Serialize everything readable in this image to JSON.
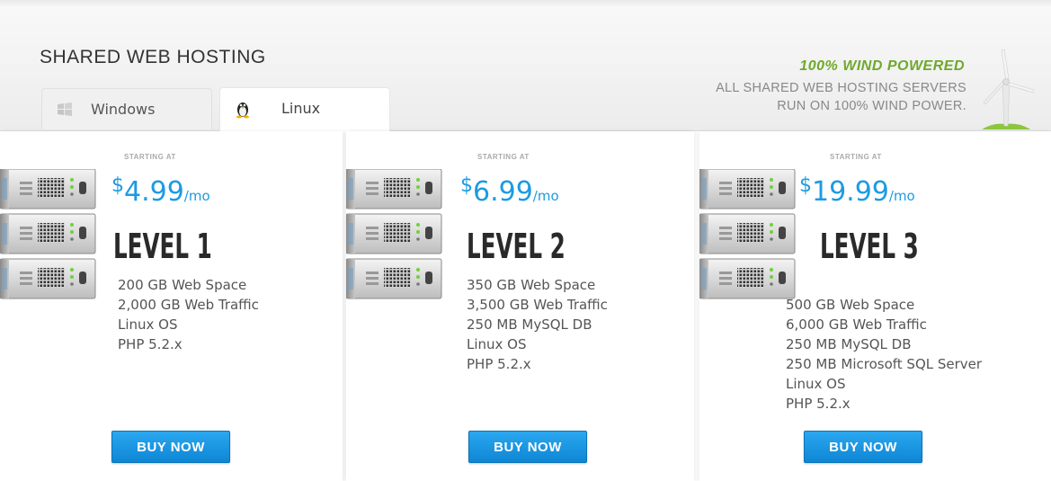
{
  "header": {
    "title": "SHARED WEB HOSTING",
    "tabs": [
      {
        "label": "Windows",
        "icon": "windows-logo-icon"
      },
      {
        "label": "Linux",
        "icon": "tux-penguin-icon"
      }
    ],
    "wind": {
      "headline": "100% WIND POWERED",
      "line1": "ALL SHARED WEB HOSTING SERVERS",
      "line2": "RUN ON 100% WIND POWER.",
      "color": "#6fa82b"
    }
  },
  "colors": {
    "price": "#1d9be2",
    "button": "#1592dd"
  },
  "plans": [
    {
      "starting": "STARTING AT",
      "currency": "$",
      "amount": "4.99",
      "period": "/mo",
      "name": "LEVEL 1",
      "features": [
        "200 GB Web Space",
        "2,000 GB Web Traffic",
        "Linux OS",
        "PHP 5.2.x"
      ],
      "button": "BUY NOW"
    },
    {
      "starting": "STARTING AT",
      "currency": "$",
      "amount": "6.99",
      "period": "/mo",
      "name": "LEVEL 2",
      "features": [
        "350 GB Web Space",
        "3,500 GB Web Traffic",
        "250 MB MySQL DB",
        "Linux OS",
        "PHP 5.2.x"
      ],
      "button": "BUY NOW"
    },
    {
      "starting": "STARTING AT",
      "currency": "$",
      "amount": "19.99",
      "period": "/mo",
      "name": "LEVEL 3",
      "features": [
        "500 GB Web Space",
        "6,000 GB Web Traffic",
        "250 MB MySQL DB",
        "250 MB Microsoft SQL Server",
        "Linux OS",
        "PHP 5.2.x"
      ],
      "button": "BUY NOW"
    }
  ]
}
